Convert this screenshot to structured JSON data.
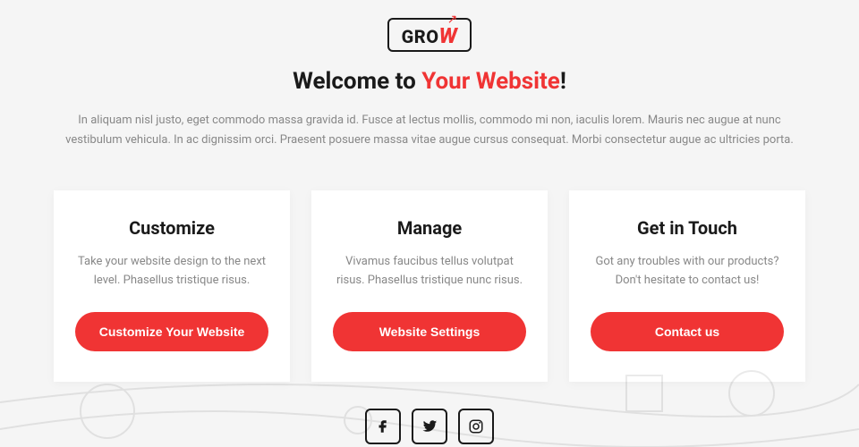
{
  "logo": {
    "text_part1": "GRO",
    "text_part2": "W"
  },
  "hero": {
    "title_prefix": "Welcome to ",
    "title_highlight": "Your Website",
    "title_suffix": "!",
    "description": "In aliquam nisl justo, eget commodo massa gravida id. Fusce at lectus mollis, commodo mi non, iaculis lorem. Mauris nec augue at nunc vestibulum vehicula. In ac dignissim orci. Praesent posuere massa vitae augue cursus consequat. Morbi consectetur augue ac ultricies porta."
  },
  "cards": [
    {
      "title": "Customize",
      "description": "Take your website design to the next level. Phasellus tristique risus.",
      "button": "Customize Your Website"
    },
    {
      "title": "Manage",
      "description": "Vivamus faucibus tellus volutpat risus. Phasellus tristique nunc risus.",
      "button": "Website Settings"
    },
    {
      "title": "Get in Touch",
      "description": "Got any troubles with our products? Don't hesitate to contact us!",
      "button": "Contact us"
    }
  ],
  "colors": {
    "accent": "#f03434",
    "text": "#1a1a1a",
    "muted": "#888"
  }
}
